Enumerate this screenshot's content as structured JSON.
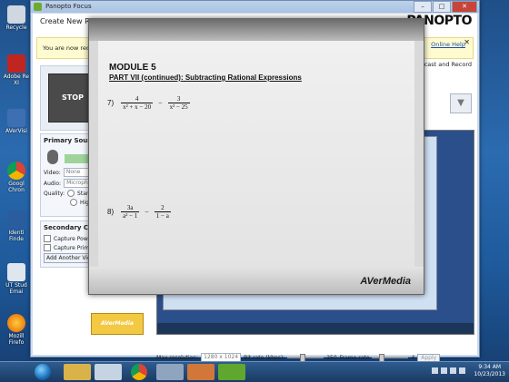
{
  "desktop": {
    "icons": [
      {
        "label1": "Recycle",
        "label2": ""
      },
      {
        "label1": "Adobe Re",
        "label2": "XI"
      },
      {
        "label1": "AVerVisi",
        "label2": ""
      },
      {
        "label1": "Googl",
        "label2": "Chron"
      },
      {
        "label1": "Identi",
        "label2": "Finde"
      },
      {
        "label1": "UT Stud",
        "label2": "Emai"
      },
      {
        "label1": "Mozill",
        "label2": "Firefo"
      }
    ]
  },
  "panopto": {
    "window_title": "Panopto Focus",
    "header_title": "Create New Rec",
    "brand": "PANOPTO",
    "notice_text": "You are now reco",
    "notice_help": "Online Help",
    "stop_label": "STOP",
    "right_label": "bcast and Record",
    "primary_source": {
      "title": "Primary Source",
      "video_label": "Video:",
      "video_value": "None",
      "audio_label": "Audio:",
      "audio_value": "Micropho",
      "quality_label": "Quality:",
      "quality_opt1": "Standa",
      "quality_opt2": "High"
    },
    "secondary_capture": {
      "title": "Secondary Captu",
      "opt1": "Capture PowerP",
      "opt2": "Capture Primary",
      "add_button": "Add Another Videc"
    },
    "bottom": {
      "max_res_label": "Max resolution:",
      "max_res_value": "1280 x 1024",
      "bitrate_label": "Bit rate (kbps):",
      "bitrate_value": "250",
      "framerate_label": "Frame rate",
      "framerate_value": "4",
      "apply_label": "Apply"
    },
    "aver_logo": "AVerMedia"
  },
  "document": {
    "module": "MODULE 5",
    "part": "PART VII (continued):  Subtracting Rational Expressions",
    "p7": {
      "num": "7)",
      "n1": "4",
      "d1": "x² + x − 20",
      "op": "−",
      "n2": "3",
      "d2": "x² − 25"
    },
    "p8": {
      "num": "8)",
      "n1": "3a",
      "d1": "a² − 1",
      "op": "−",
      "n2": "2",
      "d2": "1 − a"
    },
    "brand": "AVerMedia"
  },
  "taskbar": {
    "time": "9:34 AM",
    "date": "10/23/2013"
  }
}
